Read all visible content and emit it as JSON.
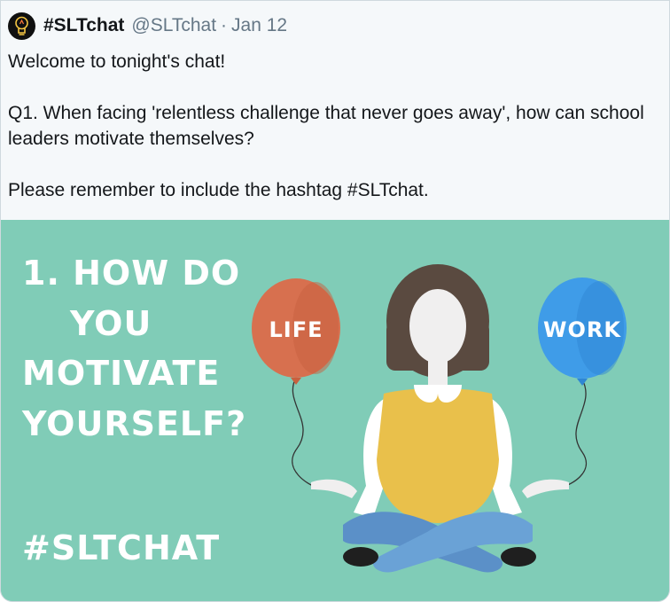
{
  "tweet": {
    "display_name": "#SLTchat",
    "handle": "@SLTchat",
    "separator": "·",
    "date": "Jan 12",
    "lines": [
      "Welcome to tonight's chat!",
      "Q1. When facing 'relentless challenge that never goes away', how can school leaders motivate themselves?",
      "Please remember to include the hashtag #SLTchat."
    ]
  },
  "image": {
    "headline_lines": [
      "1. HOW DO",
      "YOU",
      "MOTIVATE",
      "YOURSELF?"
    ],
    "hashtag": "#SLTCHAT",
    "balloon_left": "LIFE",
    "balloon_right": "WORK",
    "colors": {
      "background": "#80ccb7",
      "balloon_left": "#d7704f",
      "balloon_right": "#3f9ce8",
      "vest": "#e9c04b",
      "pants": "#5b90c8",
      "hair": "#5a4a40"
    }
  }
}
